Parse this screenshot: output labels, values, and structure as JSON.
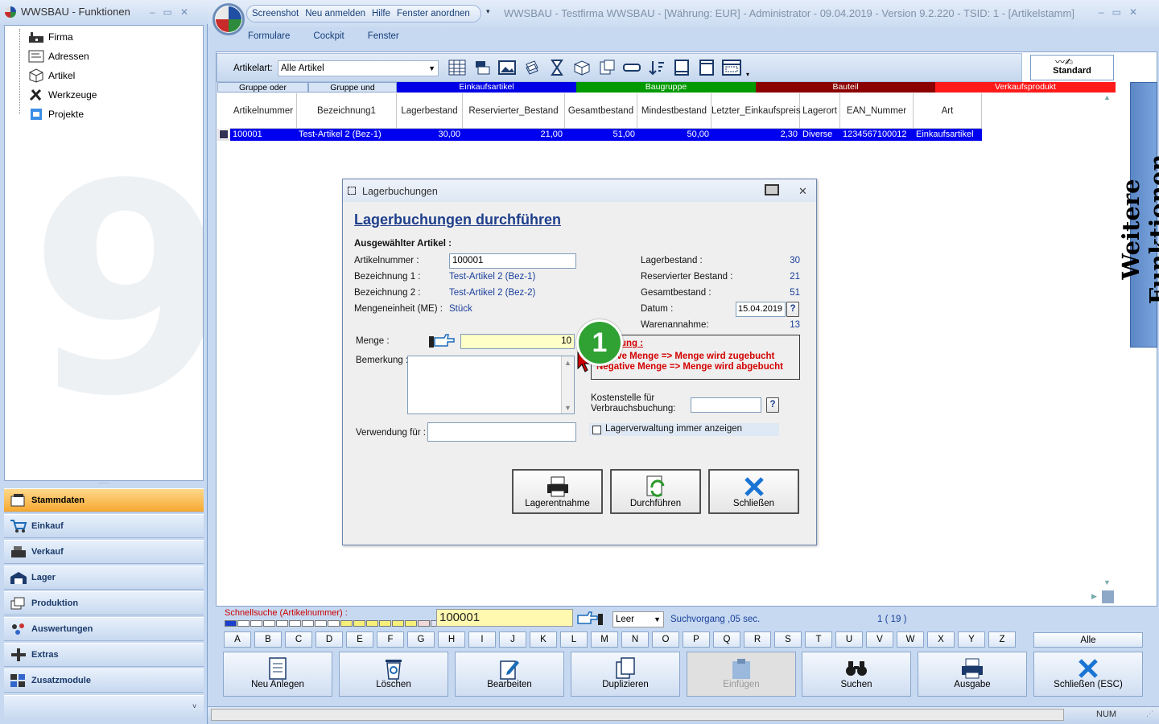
{
  "left": {
    "title": "WWSBAU - Funktionen",
    "tree": [
      "Firma",
      "Adressen",
      "Artikel",
      "Werkzeuge",
      "Projekte"
    ],
    "nav": [
      "Stammdaten",
      "Einkauf",
      "Verkauf",
      "Lager",
      "Produktion",
      "Auswertungen",
      "Extras",
      "Zusatzmodule"
    ]
  },
  "app": {
    "qat": [
      "Screenshot",
      "Neu anmelden",
      "Hilfe",
      "Fenster anordnen"
    ],
    "title": "WWSBAU - Testfirma WWSBAU - [Währung: EUR] - Administrator - 09.04.2019 - Version 9.2.220 - TSID: 1  - [Artikelstamm]",
    "menu": [
      "Formulare",
      "Cockpit",
      "Fenster"
    ]
  },
  "toolbar": {
    "artikelart_label": "Artikelart:",
    "artikelart_value": "Alle Artikel",
    "standard": "Standard"
  },
  "groupbar": [
    {
      "label": "Gruppe oder",
      "bg": "#d6e4f5",
      "fg": "#000"
    },
    {
      "label": "Gruppe und",
      "bg": "#d6e4f5",
      "fg": "#000"
    },
    {
      "label": "Einkaufsartikel",
      "bg": "#0000e6",
      "fg": "#ffffff"
    },
    {
      "label": "Baugruppe",
      "bg": "#009a00",
      "fg": "#ffffff"
    },
    {
      "label": "Bauteil",
      "bg": "#8b0000",
      "fg": "#ffffff"
    },
    {
      "label": "Verkaufsprodukt",
      "bg": "#ff1a1a",
      "fg": "#ffffff"
    }
  ],
  "grid": {
    "headers": [
      "Artikelnummer",
      "Bezeichnung1",
      "Lagerbestand",
      "Reservierter_Bestand",
      "Gesamtbestand",
      "Mindestbestand",
      "Letzter_Einkaufspreis",
      "Lagerort",
      "EAN_Nummer",
      "Art"
    ],
    "row": [
      "100001",
      "Test-Artikel 2  (Bez-1)",
      "30,00",
      "21,00",
      "51,00",
      "50,00",
      "2,30",
      "Diverse",
      "1234567100012",
      "Einkaufsartikel"
    ]
  },
  "dialog": {
    "title": "Lagerbuchungen",
    "heading": "Lagerbuchungen durchführen",
    "section": "Ausgewählter Artikel :",
    "artikelnummer_label": "Artikelnummer :",
    "artikelnummer": "100001",
    "bez1_label": "Bezeichnung 1 :",
    "bez1": "Test-Artikel 2  (Bez-1)",
    "bez2_label": "Bezeichnung 2 :",
    "bez2": "Test-Artikel 2  (Bez-2)",
    "me_label": "Mengeneinheit (ME) :",
    "me": "Stück",
    "lagerbestand_label": "Lagerbestand :",
    "lagerbestand": "30",
    "reserviert_label": "Reservierter Bestand :",
    "reserviert": "21",
    "gesamt_label": "Gesamtbestand :",
    "gesamt": "51",
    "datum_label": "Datum :",
    "datum": "15.04.2019",
    "help": "?",
    "warenannahme_label": "Warenannahme:",
    "warenannahme": "13",
    "menge_label": "Menge :",
    "menge": "10",
    "bemerkung_label": "Bemerkung :",
    "verwendung_label": "Verwendung für :",
    "hint_title": "ung :",
    "hint_line1": "ive Menge => Menge wird zugebucht",
    "hint_line2": "Negative Menge  => Menge wird abgebucht",
    "kostenstelle_label1": "Kostenstelle für",
    "kostenstelle_label2": "Verbrauchsbuchung:",
    "lagerverwaltung_label": "Lagerverwaltung immer anzeigen",
    "btn_lagerentnahme": "Lagerentnahme",
    "btn_durchfuehren": "Durchführen",
    "btn_schliessen": "Schließen"
  },
  "badge": "1",
  "search": {
    "label": "Schnellsuche (Artikelnummer) :",
    "value": "100001",
    "leer": "Leer",
    "status": "Suchvorgang ,05 sec.",
    "count": "1  ( 19 )"
  },
  "letters": [
    "A",
    "B",
    "C",
    "D",
    "E",
    "F",
    "G",
    "H",
    "I",
    "J",
    "K",
    "L",
    "M",
    "N",
    "O",
    "P",
    "Q",
    "R",
    "S",
    "T",
    "U",
    "V",
    "W",
    "X",
    "Y",
    "Z"
  ],
  "alle": "Alle",
  "bottom_buttons": [
    "Neu Anlegen",
    "Löschen",
    "Bearbeiten",
    "Duplizieren",
    "Einfügen",
    "Suchen",
    "Ausgabe",
    "Schließen (ESC)"
  ],
  "status": {
    "num": "NUM"
  },
  "sidetab": "Weitere Funktionen"
}
